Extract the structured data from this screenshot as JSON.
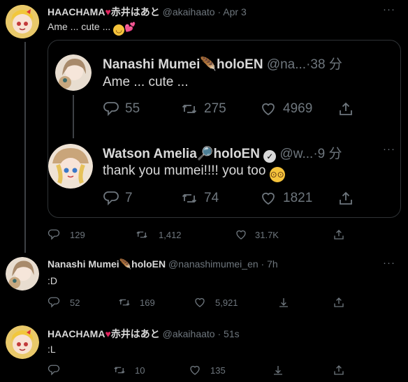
{
  "main_tweet": {
    "name": "HAACHAMA",
    "name_suffix": "赤井はあと",
    "handle": "@akaihaato",
    "sep": "·",
    "time": "Apr 3",
    "text": "Ame ... cute ...",
    "stats": {
      "replies": "129",
      "retweets": "1,412",
      "likes": "31.7K"
    },
    "quote": {
      "tweet1": {
        "name": "Nanashi Mumei",
        "name_suffix": "holoEN",
        "handle": "@na...",
        "sep": "·",
        "time": "38 分",
        "text": "Ame ... cute ...",
        "stats": {
          "replies": "55",
          "retweets": "275",
          "likes": "4969"
        }
      },
      "tweet2": {
        "name": "Watson Amelia",
        "name_suffix": "holoEN",
        "handle": "@w...",
        "sep": "·",
        "time": "9 分",
        "text": "thank you mumei!!!! you too",
        "stats": {
          "replies": "7",
          "retweets": "74",
          "likes": "1821"
        }
      }
    }
  },
  "reply1": {
    "name": "Nanashi Mumei",
    "name_suffix": "holoEN",
    "handle": "@nanashimumei_en",
    "sep": "·",
    "time": "7h",
    "text": ":D",
    "stats": {
      "replies": "52",
      "retweets": "169",
      "likes": "5,921"
    }
  },
  "reply2": {
    "name": "HAACHAMA",
    "name_suffix": "赤井はあと",
    "handle": "@akaihaato",
    "sep": "·",
    "time": "51s",
    "text": ":L",
    "stats": {
      "retweets": "10",
      "likes": "135"
    }
  },
  "more_label": "···",
  "colors": {
    "background": "#000000",
    "text": "#d9d9d9",
    "muted": "#6e767d",
    "border": "#2f3336",
    "verified": "#d9d9d9"
  }
}
